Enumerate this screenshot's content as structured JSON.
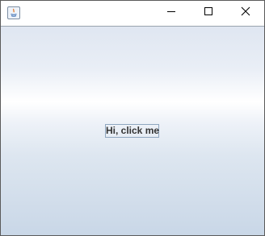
{
  "window": {
    "title": "",
    "controls": {
      "minimize_icon": "minimize-icon",
      "maximize_icon": "maximize-icon",
      "close_icon": "close-icon"
    }
  },
  "main": {
    "button_label": "Hi, click me"
  },
  "colors": {
    "gradient_top": "#dfe6f1",
    "gradient_highlight": "#ffffff",
    "gradient_bottom": "#c9d7e7",
    "button_border": "#8fa6bf",
    "button_text": "#333333"
  }
}
